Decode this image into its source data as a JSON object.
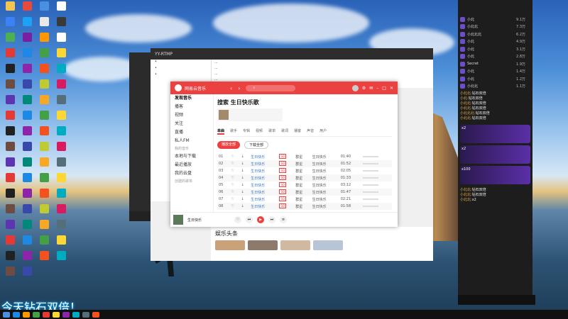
{
  "desktop": {
    "icon_colors": [
      "#f3c64f",
      "#e64a3b",
      "#4a90e2",
      "#ffffff",
      "#3b82f6",
      "#1da1f2",
      "#e9e9e9",
      "#3a3a3a",
      "#4caf50",
      "#7b1fa2",
      "#ff9800",
      "#ffffff",
      "#e53935",
      "#1e88e5",
      "#43a047",
      "#fdd835",
      "#212121",
      "#8e24aa",
      "#f4511e",
      "#00acc1",
      "#6d4c41",
      "#3949ab",
      "#c0ca33",
      "#d81b60",
      "#5e35b1",
      "#00897b",
      "#f9a825",
      "#546e7a",
      "#e53935",
      "#1e88e5",
      "#43a047",
      "#fdd835",
      "#212121",
      "#8e24aa",
      "#f4511e",
      "#00acc1",
      "#6d4c41",
      "#3949ab",
      "#c0ca33",
      "#d81b60",
      "#5e35b1",
      "#00897b",
      "#f9a825",
      "#546e7a",
      "#e53935",
      "#1e88e5",
      "#43a047",
      "#fdd835",
      "#212121",
      "#8e24aa",
      "#f4511e",
      "#00acc1",
      "#6d4c41",
      "#3949ab",
      "#c0ca33",
      "#d81b60",
      "#5e35b1",
      "#00897b",
      "#f9a825",
      "#546e7a",
      "#e53935",
      "#1e88e5",
      "#43a047",
      "#fdd835",
      "#212121",
      "#8e24aa",
      "#f4511e",
      "#00acc1",
      "#6d4c41",
      "#3949ab"
    ]
  },
  "browser": {
    "title": "YY-RTMP",
    "news": [
      "...",
      "...",
      "...",
      "..."
    ],
    "feed_title": "娱乐头条"
  },
  "music": {
    "app_title": "网易云音乐",
    "sidebar": [
      "发现音乐",
      "播客",
      "视频",
      "关注",
      "直播",
      "私人FM"
    ],
    "sidebar_header": "我的音乐",
    "sidebar_items2": [
      "本地与下载",
      "最近播放",
      "我的云盘"
    ],
    "sidebar_header2": "创建的歌单",
    "playlist_title": "搜索 生日快乐歌",
    "tabs": [
      "单曲",
      "歌手",
      "专辑",
      "视频",
      "歌单",
      "歌词",
      "播客",
      "声音",
      "用户"
    ],
    "play_all": "播放全部",
    "download_all": "下载全部",
    "songs": [
      {
        "num": "01",
        "title": "生日快乐",
        "artist": "群星",
        "album": "生日快乐",
        "time": "01:40"
      },
      {
        "num": "02",
        "title": "生日快乐",
        "artist": "群星",
        "album": "生日快乐",
        "time": "01:52"
      },
      {
        "num": "03",
        "title": "生日快乐",
        "artist": "群星",
        "album": "生日快乐",
        "time": "02:05"
      },
      {
        "num": "04",
        "title": "生日快乐",
        "artist": "群星",
        "album": "生日快乐",
        "time": "01:33"
      },
      {
        "num": "05",
        "title": "生日快乐",
        "artist": "群星",
        "album": "生日快乐",
        "time": "03:12"
      },
      {
        "num": "06",
        "title": "生日快乐",
        "artist": "群星",
        "album": "生日快乐",
        "time": "01:47"
      },
      {
        "num": "07",
        "title": "生日快乐",
        "artist": "群星",
        "album": "生日快乐",
        "time": "02:21"
      },
      {
        "num": "08",
        "title": "生日快乐",
        "artist": "群星",
        "album": "生日快乐",
        "time": "01:58"
      }
    ],
    "now_playing": "生日快乐"
  },
  "live": {
    "ranks": [
      {
        "name": "小北",
        "value": "9.1万"
      },
      {
        "name": "小北北",
        "value": "7.3万"
      },
      {
        "name": "小北北北",
        "value": "6.2万"
      },
      {
        "name": "小北",
        "value": "4.9万"
      },
      {
        "name": "小北",
        "value": "3.1万"
      },
      {
        "name": "小北",
        "value": "2.8万"
      },
      {
        "name": "Secret",
        "value": "1.9万"
      },
      {
        "name": "小北",
        "value": "1.4万"
      },
      {
        "name": "小北",
        "value": "1.2万"
      },
      {
        "name": "小北北",
        "value": "1.1万"
      }
    ],
    "chat": [
      {
        "user": "小北北:",
        "msg": "钻石双倍"
      },
      {
        "user": "小北:",
        "msg": "钻石双倍"
      },
      {
        "user": "小北北:",
        "msg": "钻石双倍"
      },
      {
        "user": "小北北:",
        "msg": "钻石双倍"
      },
      {
        "user": "小北北北:",
        "msg": "钻石双倍"
      },
      {
        "user": "小北北:",
        "msg": "钻石双倍"
      }
    ],
    "gift_banners": [
      "x2",
      "x2",
      "x100"
    ],
    "more_chat": [
      {
        "user": "小北北:",
        "msg": "钻石双倍"
      },
      {
        "user": "小北北:",
        "msg": "钻石双倍"
      },
      {
        "user": "小北北:",
        "msg": "x2"
      }
    ]
  },
  "overlay": {
    "text": "今天钻石双倍！"
  },
  "taskbar": {
    "colors": [
      "#1e88e5",
      "#ff9800",
      "#43a047",
      "#e53935",
      "#fdd835",
      "#8e24aa",
      "#00acc1",
      "#546e7a",
      "#f4511e"
    ]
  }
}
